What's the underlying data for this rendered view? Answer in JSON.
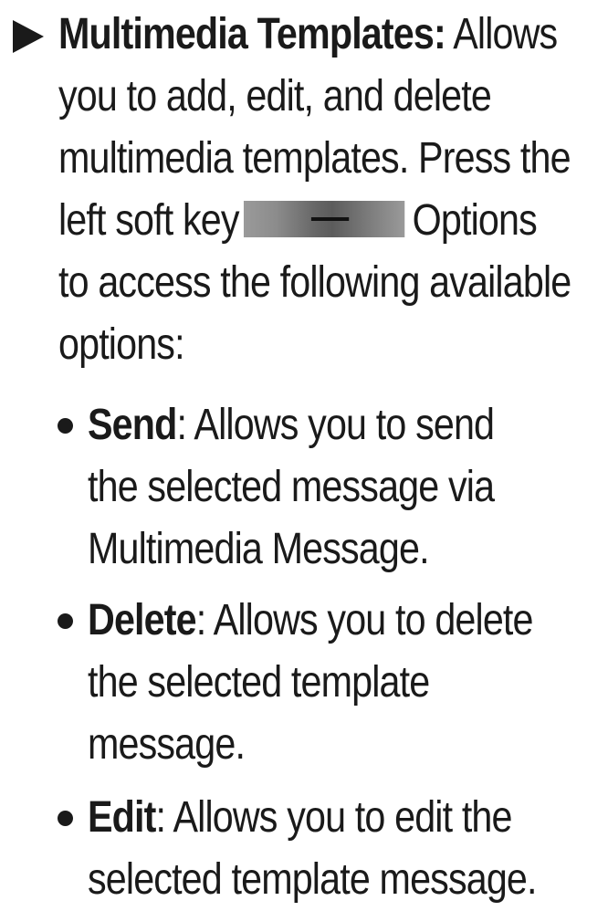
{
  "main": {
    "title": "Multimedia Templates:",
    "line1_rest": " Allows",
    "line2": "you to add, edit, and delete",
    "line3": "multimedia templates. Press the",
    "line4_start": "left soft key",
    "line4_end": "Options",
    "line5": "to access the following available",
    "line6": "options:",
    "softkey_icon": "left-soft-key-icon"
  },
  "options": [
    {
      "label": "Send",
      "line1_rest": ": Allows you to send",
      "line2": "the selected message via",
      "line3": "Multimedia Message."
    },
    {
      "label": "Delete",
      "line1_rest": ": Allows you to delete",
      "line2": "the selected template",
      "line3": "message."
    },
    {
      "label": "Edit",
      "line1_rest": ": Allows you to edit the",
      "line2": "selected template message.",
      "line3": ""
    }
  ]
}
